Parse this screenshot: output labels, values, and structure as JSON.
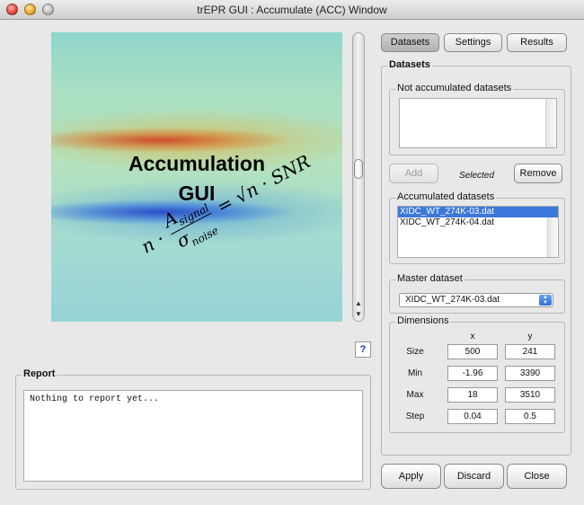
{
  "window": {
    "title": "trEPR GUI : Accumulate (ACC) Window"
  },
  "image": {
    "label_line1": "Accumulation",
    "label_line2": "GUI",
    "formula": {
      "n": "n",
      "dot": "·",
      "num": "A",
      "num_sub": "signal",
      "den": "σ",
      "den_sub": "noise",
      "eq": "=",
      "sqrt": "√n",
      "snr": "· SNR"
    }
  },
  "help": {
    "label": "?"
  },
  "report": {
    "legend": "Report",
    "text": "Nothing to report yet..."
  },
  "tabs": [
    {
      "label": "Datasets",
      "active": true
    },
    {
      "label": "Settings",
      "active": false
    },
    {
      "label": "Results",
      "active": false
    }
  ],
  "datasets": {
    "legend": "Datasets",
    "not_accumulated": {
      "legend": "Not accumulated datasets",
      "items": []
    },
    "add_label": "Add",
    "selected_label": "Selected",
    "remove_label": "Remove",
    "accumulated": {
      "legend": "Accumulated datasets",
      "items": [
        "XIDC_WT_274K-03.dat",
        "XIDC_WT_274K-04.dat"
      ]
    },
    "master": {
      "legend": "Master dataset",
      "value": "XIDC_WT_274K-03.dat"
    },
    "dimensions": {
      "legend": "Dimensions",
      "col_x": "x",
      "col_y": "y",
      "rows": [
        {
          "label": "Size",
          "x": "500",
          "y": "241"
        },
        {
          "label": "Min",
          "x": "-1.96",
          "y": "3390"
        },
        {
          "label": "Max",
          "x": "18",
          "y": "3510"
        },
        {
          "label": "Step",
          "x": "0.04",
          "y": "0.5"
        }
      ]
    }
  },
  "footer": {
    "apply": "Apply",
    "discard": "Discard",
    "close": "Close"
  }
}
